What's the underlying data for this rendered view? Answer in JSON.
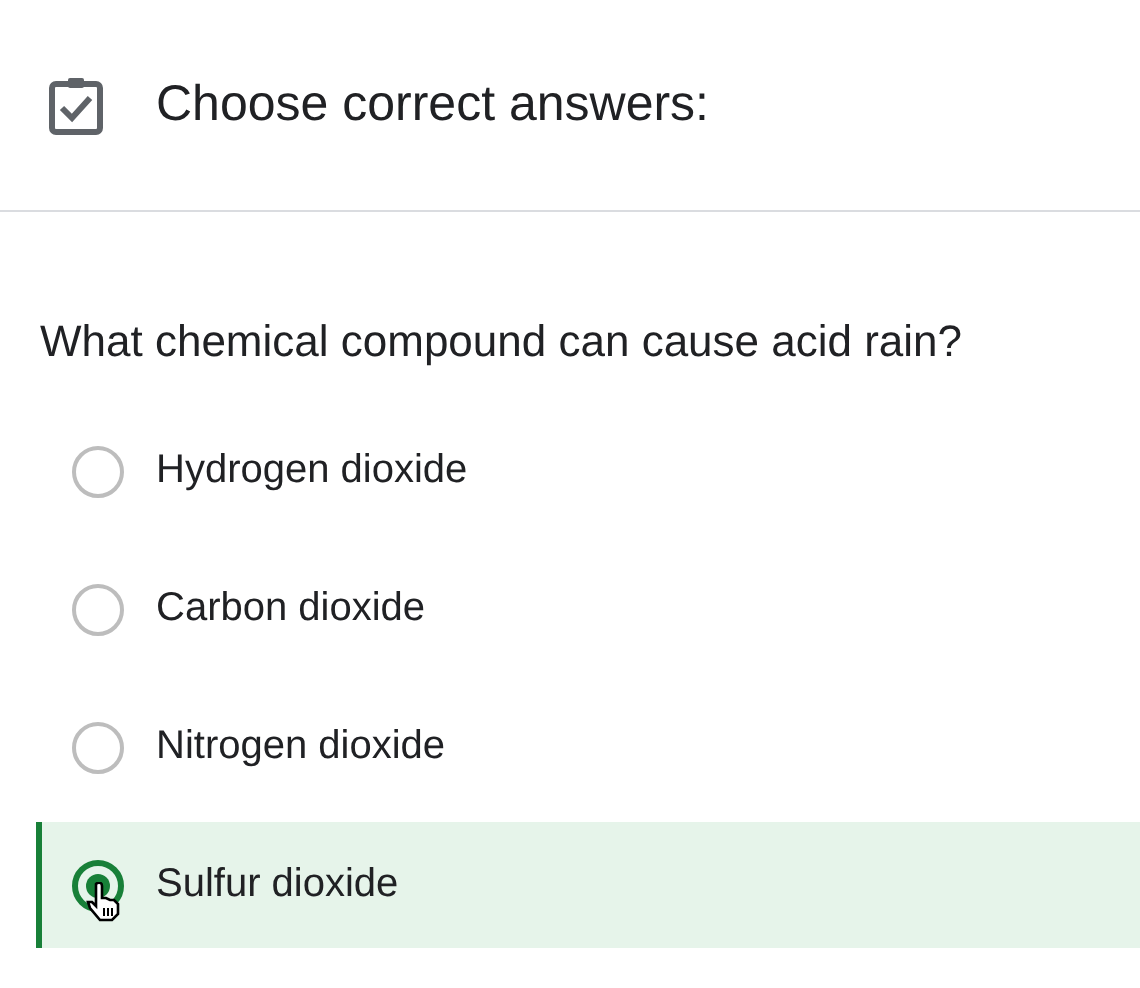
{
  "header": {
    "title": "Choose correct answers:"
  },
  "question": "What chemical compound can cause acid rain?",
  "options": [
    {
      "label": "Hydrogen dioxide",
      "selected": false
    },
    {
      "label": "Carbon dioxide",
      "selected": false
    },
    {
      "label": "Nitrogen dioxide",
      "selected": false
    },
    {
      "label": "Sulfur dioxide",
      "selected": true
    }
  ]
}
